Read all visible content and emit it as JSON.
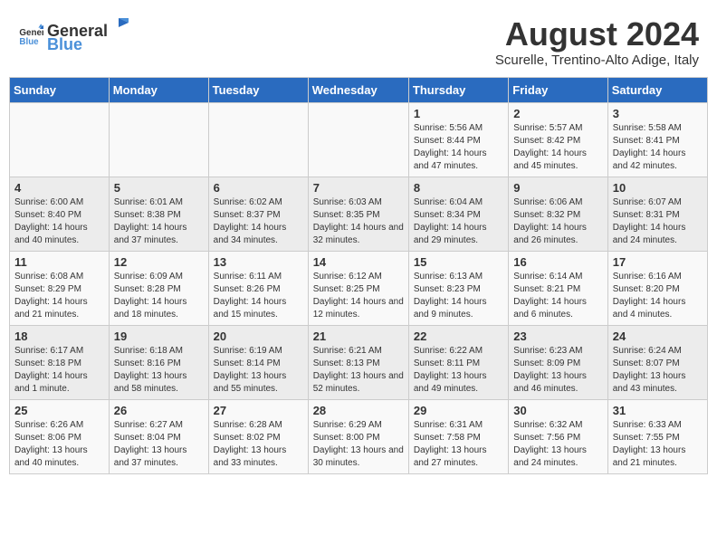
{
  "header": {
    "logo_general": "General",
    "logo_blue": "Blue",
    "month_year": "August 2024",
    "location": "Scurelle, Trentino-Alto Adige, Italy"
  },
  "weekdays": [
    "Sunday",
    "Monday",
    "Tuesday",
    "Wednesday",
    "Thursday",
    "Friday",
    "Saturday"
  ],
  "weeks": [
    [
      {
        "day": "",
        "detail": ""
      },
      {
        "day": "",
        "detail": ""
      },
      {
        "day": "",
        "detail": ""
      },
      {
        "day": "",
        "detail": ""
      },
      {
        "day": "1",
        "detail": "Sunrise: 5:56 AM\nSunset: 8:44 PM\nDaylight: 14 hours and 47 minutes."
      },
      {
        "day": "2",
        "detail": "Sunrise: 5:57 AM\nSunset: 8:42 PM\nDaylight: 14 hours and 45 minutes."
      },
      {
        "day": "3",
        "detail": "Sunrise: 5:58 AM\nSunset: 8:41 PM\nDaylight: 14 hours and 42 minutes."
      }
    ],
    [
      {
        "day": "4",
        "detail": "Sunrise: 6:00 AM\nSunset: 8:40 PM\nDaylight: 14 hours and 40 minutes."
      },
      {
        "day": "5",
        "detail": "Sunrise: 6:01 AM\nSunset: 8:38 PM\nDaylight: 14 hours and 37 minutes."
      },
      {
        "day": "6",
        "detail": "Sunrise: 6:02 AM\nSunset: 8:37 PM\nDaylight: 14 hours and 34 minutes."
      },
      {
        "day": "7",
        "detail": "Sunrise: 6:03 AM\nSunset: 8:35 PM\nDaylight: 14 hours and 32 minutes."
      },
      {
        "day": "8",
        "detail": "Sunrise: 6:04 AM\nSunset: 8:34 PM\nDaylight: 14 hours and 29 minutes."
      },
      {
        "day": "9",
        "detail": "Sunrise: 6:06 AM\nSunset: 8:32 PM\nDaylight: 14 hours and 26 minutes."
      },
      {
        "day": "10",
        "detail": "Sunrise: 6:07 AM\nSunset: 8:31 PM\nDaylight: 14 hours and 24 minutes."
      }
    ],
    [
      {
        "day": "11",
        "detail": "Sunrise: 6:08 AM\nSunset: 8:29 PM\nDaylight: 14 hours and 21 minutes."
      },
      {
        "day": "12",
        "detail": "Sunrise: 6:09 AM\nSunset: 8:28 PM\nDaylight: 14 hours and 18 minutes."
      },
      {
        "day": "13",
        "detail": "Sunrise: 6:11 AM\nSunset: 8:26 PM\nDaylight: 14 hours and 15 minutes."
      },
      {
        "day": "14",
        "detail": "Sunrise: 6:12 AM\nSunset: 8:25 PM\nDaylight: 14 hours and 12 minutes."
      },
      {
        "day": "15",
        "detail": "Sunrise: 6:13 AM\nSunset: 8:23 PM\nDaylight: 14 hours and 9 minutes."
      },
      {
        "day": "16",
        "detail": "Sunrise: 6:14 AM\nSunset: 8:21 PM\nDaylight: 14 hours and 6 minutes."
      },
      {
        "day": "17",
        "detail": "Sunrise: 6:16 AM\nSunset: 8:20 PM\nDaylight: 14 hours and 4 minutes."
      }
    ],
    [
      {
        "day": "18",
        "detail": "Sunrise: 6:17 AM\nSunset: 8:18 PM\nDaylight: 14 hours and 1 minute."
      },
      {
        "day": "19",
        "detail": "Sunrise: 6:18 AM\nSunset: 8:16 PM\nDaylight: 13 hours and 58 minutes."
      },
      {
        "day": "20",
        "detail": "Sunrise: 6:19 AM\nSunset: 8:14 PM\nDaylight: 13 hours and 55 minutes."
      },
      {
        "day": "21",
        "detail": "Sunrise: 6:21 AM\nSunset: 8:13 PM\nDaylight: 13 hours and 52 minutes."
      },
      {
        "day": "22",
        "detail": "Sunrise: 6:22 AM\nSunset: 8:11 PM\nDaylight: 13 hours and 49 minutes."
      },
      {
        "day": "23",
        "detail": "Sunrise: 6:23 AM\nSunset: 8:09 PM\nDaylight: 13 hours and 46 minutes."
      },
      {
        "day": "24",
        "detail": "Sunrise: 6:24 AM\nSunset: 8:07 PM\nDaylight: 13 hours and 43 minutes."
      }
    ],
    [
      {
        "day": "25",
        "detail": "Sunrise: 6:26 AM\nSunset: 8:06 PM\nDaylight: 13 hours and 40 minutes."
      },
      {
        "day": "26",
        "detail": "Sunrise: 6:27 AM\nSunset: 8:04 PM\nDaylight: 13 hours and 37 minutes."
      },
      {
        "day": "27",
        "detail": "Sunrise: 6:28 AM\nSunset: 8:02 PM\nDaylight: 13 hours and 33 minutes."
      },
      {
        "day": "28",
        "detail": "Sunrise: 6:29 AM\nSunset: 8:00 PM\nDaylight: 13 hours and 30 minutes."
      },
      {
        "day": "29",
        "detail": "Sunrise: 6:31 AM\nSunset: 7:58 PM\nDaylight: 13 hours and 27 minutes."
      },
      {
        "day": "30",
        "detail": "Sunrise: 6:32 AM\nSunset: 7:56 PM\nDaylight: 13 hours and 24 minutes."
      },
      {
        "day": "31",
        "detail": "Sunrise: 6:33 AM\nSunset: 7:55 PM\nDaylight: 13 hours and 21 minutes."
      }
    ]
  ]
}
